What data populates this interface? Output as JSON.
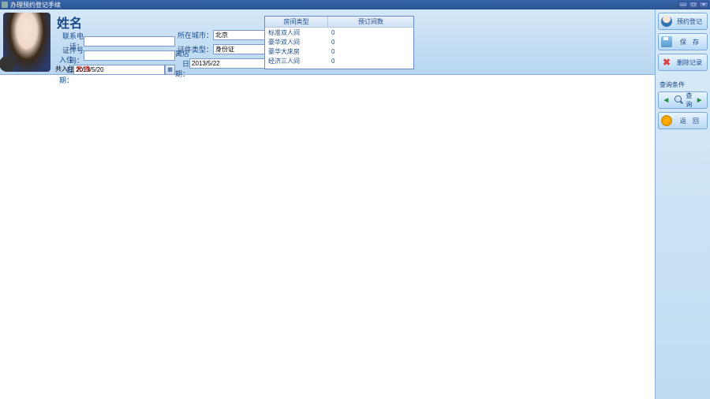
{
  "window": {
    "title": "办理预约登记手续"
  },
  "header": {
    "name_label": "姓名",
    "phone_label": "联系电话：",
    "id_label": "证件号码：",
    "checkin_label": "入住日期：",
    "checkin_value": "2013/5/20",
    "city_label": "所在城市：",
    "city_value": "北京",
    "idtype_label": "证件类型：",
    "idtype_value": "身份证",
    "checkout_label": "离店日期：",
    "checkout_value": "2013/5/22",
    "note_prefix": "共入住",
    "note_value": "天/晚"
  },
  "rooms": {
    "col1": "房间类型",
    "col2": "预订间数",
    "rows": [
      {
        "type": "标准双人间",
        "count": "0"
      },
      {
        "type": "豪华双人间",
        "count": "0"
      },
      {
        "type": "豪华大床房",
        "count": "0"
      },
      {
        "type": "经济三人间",
        "count": "0"
      }
    ]
  },
  "sidebar": {
    "btn_register": "预约登记",
    "btn_save": "保　存",
    "btn_delete": "删除记录",
    "search_header": "查询条件",
    "btn_query": "查询",
    "btn_back": "返　回"
  }
}
